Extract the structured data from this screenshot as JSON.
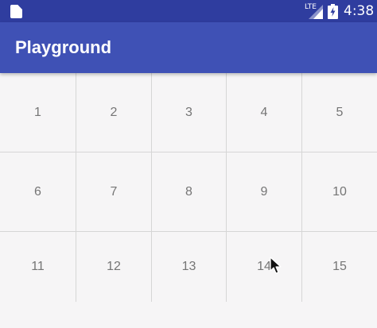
{
  "status_bar": {
    "network": "LTE",
    "time": "4:38",
    "icons": [
      "sd-card-icon",
      "signal-icon",
      "battery-charging-icon"
    ]
  },
  "app_bar": {
    "title": "Playground"
  },
  "grid": {
    "items": [
      "1",
      "2",
      "3",
      "4",
      "5",
      "6",
      "7",
      "8",
      "9",
      "10",
      "11",
      "12",
      "13",
      "14",
      "15"
    ]
  },
  "colors": {
    "status_bar": "#2f3d9f",
    "app_bar": "#3f51b5",
    "background": "#f6f5f6",
    "cell_text": "#757575",
    "divider": "#d6d6d6"
  }
}
